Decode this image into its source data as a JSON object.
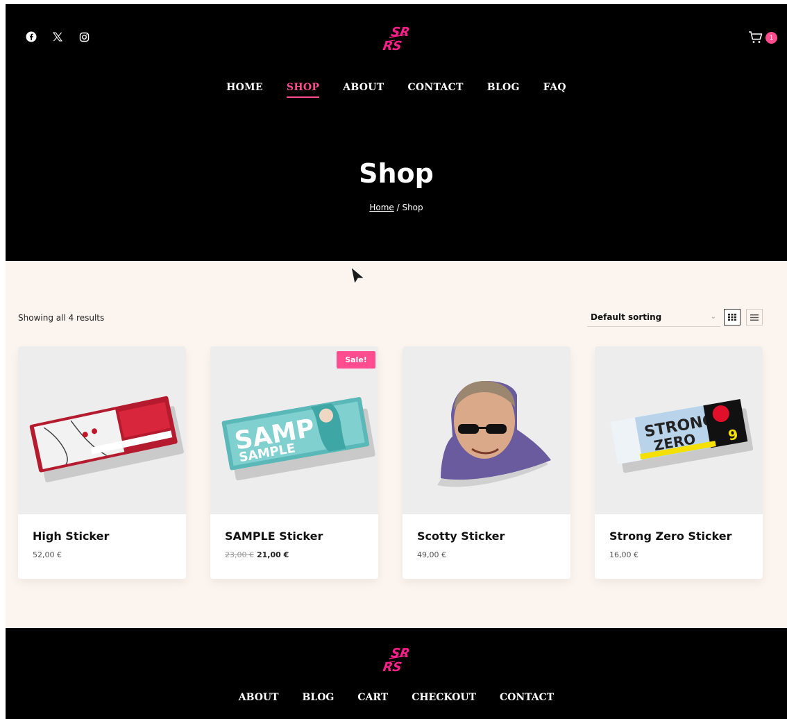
{
  "header": {
    "social_icons": [
      "facebook-icon",
      "x-icon",
      "instagram-icon"
    ],
    "logo_text": "SR RS",
    "cart_count": "1",
    "nav": [
      {
        "label": "HOME",
        "active": false
      },
      {
        "label": "SHOP",
        "active": true
      },
      {
        "label": "ABOUT",
        "active": false
      },
      {
        "label": "CONTACT",
        "active": false
      },
      {
        "label": "BLOG",
        "active": false
      },
      {
        "label": "FAQ",
        "active": false
      }
    ],
    "page_title": "Shop",
    "breadcrumb": {
      "home": "Home",
      "separator": " / ",
      "current": "Shop"
    }
  },
  "shop": {
    "result_count": "Showing all 4 results",
    "sorting": "Default sorting",
    "view_modes": [
      "grid-view-icon",
      "list-view-icon"
    ],
    "products": [
      {
        "name": "High Sticker",
        "price": "52,00 €"
      },
      {
        "name": "SAMPLE Sticker",
        "old_price": "23,00 €",
        "price": "21,00 €",
        "badge": "Sale!",
        "image_text_1": "SAMP",
        "image_text_2": "SAMPLE"
      },
      {
        "name": "Scotty Sticker",
        "price": "49,00 €"
      },
      {
        "name": "Strong Zero Sticker",
        "price": "16,00 €",
        "image_text_1": "STRONG",
        "image_text_2": "ZERO"
      }
    ]
  },
  "footer": {
    "nav": [
      "ABOUT",
      "BLOG",
      "CART",
      "CHECKOUT",
      "CONTACT"
    ]
  },
  "colors": {
    "accent": "#ff4d8f",
    "header_bg": "#000000",
    "main_bg": "#fcf5ef"
  }
}
